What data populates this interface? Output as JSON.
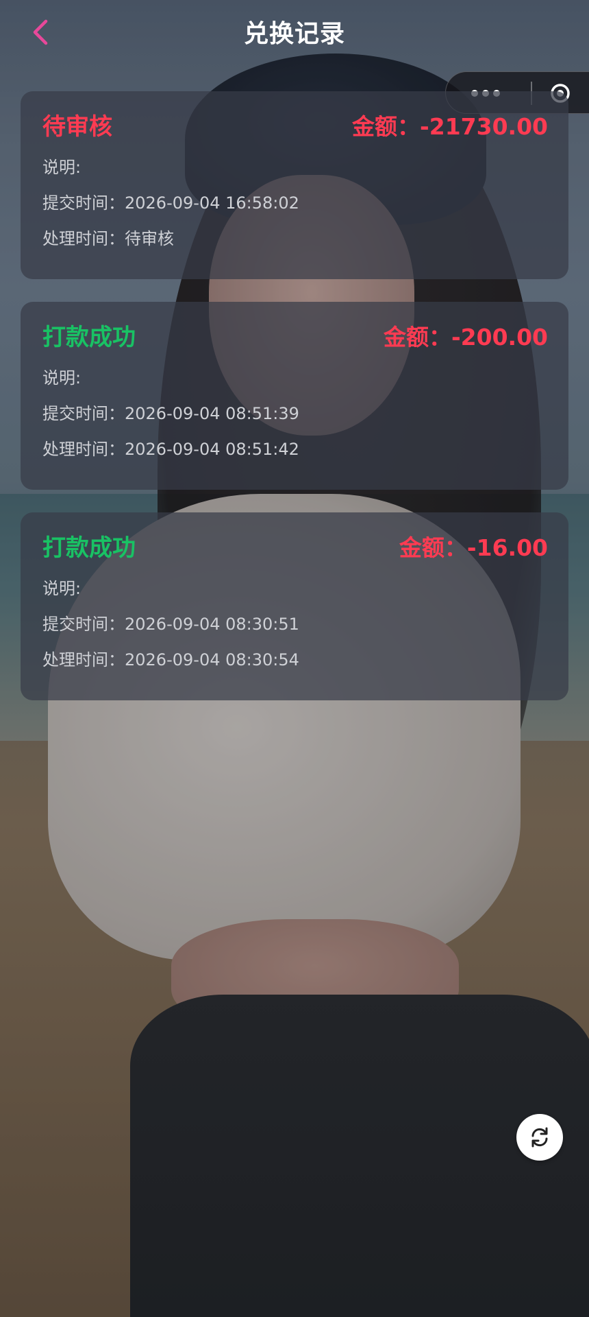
{
  "header": {
    "title": "兑换记录",
    "back_icon": "chevron-left-icon",
    "back_color": "#e8489a"
  },
  "capsule": {
    "more_icon": "more-dots-icon",
    "close_icon": "target-circle-icon"
  },
  "records": [
    {
      "status": "待审核",
      "status_color": "#ff3b52",
      "amount_label": "金额：",
      "amount": "-21730.00",
      "desc_label": "说明:",
      "desc": "",
      "submit_label": "提交时间：",
      "submit_time": "2026-09-04 16:58:02",
      "process_label": "处理时间：",
      "process_time": "待审核"
    },
    {
      "status": "打款成功",
      "status_color": "#19c264",
      "amount_label": "金额：",
      "amount": "-200.00",
      "desc_label": "说明:",
      "desc": "",
      "submit_label": "提交时间：",
      "submit_time": "2026-09-04 08:51:39",
      "process_label": "处理时间：",
      "process_time": "2026-09-04 08:51:42"
    },
    {
      "status": "打款成功",
      "status_color": "#19c264",
      "amount_label": "金额：",
      "amount": "-16.00",
      "desc_label": "说明:",
      "desc": "",
      "submit_label": "提交时间：",
      "submit_time": "2026-09-04 08:30:51",
      "process_label": "处理时间：",
      "process_time": "2026-09-04 08:30:54"
    }
  ],
  "refresh_icon": "refresh-icon",
  "colors": {
    "amount": "#ff3b52",
    "pending": "#ff3b52",
    "paid": "#19c264"
  }
}
